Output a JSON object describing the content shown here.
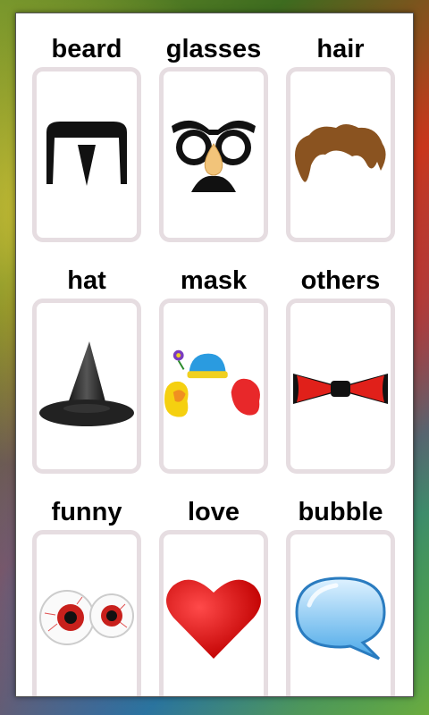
{
  "categories": [
    {
      "label": "beard",
      "icon": "beard-icon"
    },
    {
      "label": "glasses",
      "icon": "glasses-icon"
    },
    {
      "label": "hair",
      "icon": "hair-icon"
    },
    {
      "label": "hat",
      "icon": "hat-icon"
    },
    {
      "label": "mask",
      "icon": "clown-mask-icon"
    },
    {
      "label": "others",
      "icon": "bow-tie-icon"
    },
    {
      "label": "funny",
      "icon": "eyeballs-icon"
    },
    {
      "label": "love",
      "icon": "heart-icon"
    },
    {
      "label": "bubble",
      "icon": "speech-bubble-icon"
    }
  ]
}
